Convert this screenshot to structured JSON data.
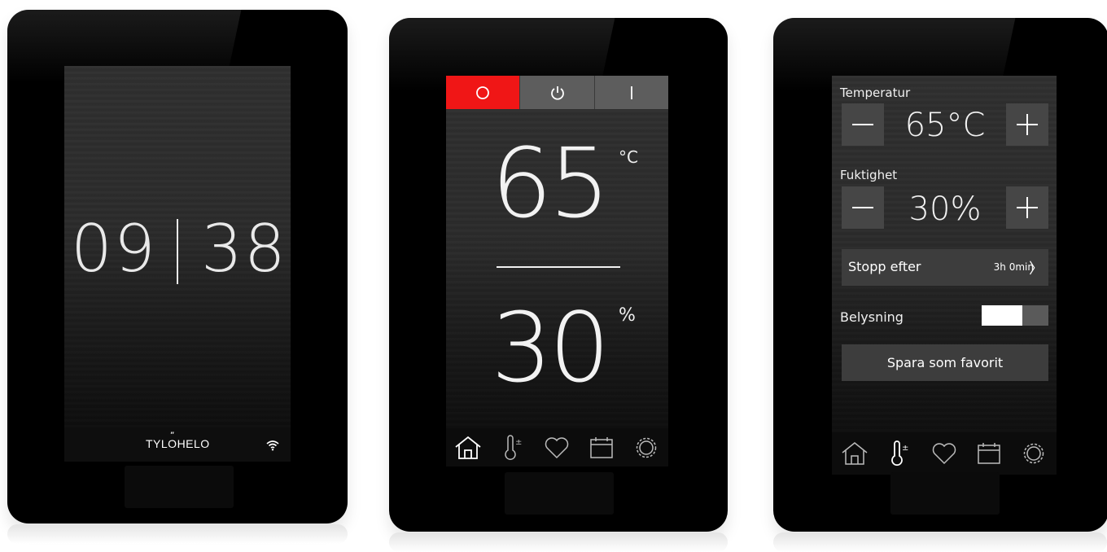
{
  "screen1": {
    "clock_hours": "09",
    "clock_minutes": "38",
    "brand": "TYLOHELO",
    "brand_marks": "″",
    "wifi_icon": "wifi-icon"
  },
  "screen2": {
    "mode_buttons": [
      {
        "label": "O",
        "icon": "off-circle-icon",
        "active": true
      },
      {
        "label": "⏻",
        "icon": "power-icon",
        "active": false
      },
      {
        "label": "I",
        "icon": "on-bar-icon",
        "active": false
      }
    ],
    "temperature": "65",
    "temperature_unit": "°C",
    "humidity": "30",
    "humidity_unit": "%",
    "active_color": "#f01616",
    "nav": [
      "home-icon",
      "thermometer-icon",
      "heart-icon",
      "calendar-icon",
      "settings-icon"
    ],
    "active_nav": "home-icon"
  },
  "screen3": {
    "temp_label": "Temperatur",
    "temp_value": "65°C",
    "humidity_label": "Fuktighet",
    "humidity_value": "30%",
    "minus": "minus-icon",
    "plus": "plus-icon",
    "stop_label": "Stopp efter",
    "stop_value": "3h 0min",
    "stop_chevron": "〉",
    "lighting_label": "Belysning",
    "lighting_on": true,
    "favorite_label": "Spara som favorit",
    "nav": [
      "home-icon",
      "thermometer-icon",
      "heart-icon",
      "calendar-icon",
      "settings-icon"
    ],
    "active_nav": "thermometer-icon"
  }
}
